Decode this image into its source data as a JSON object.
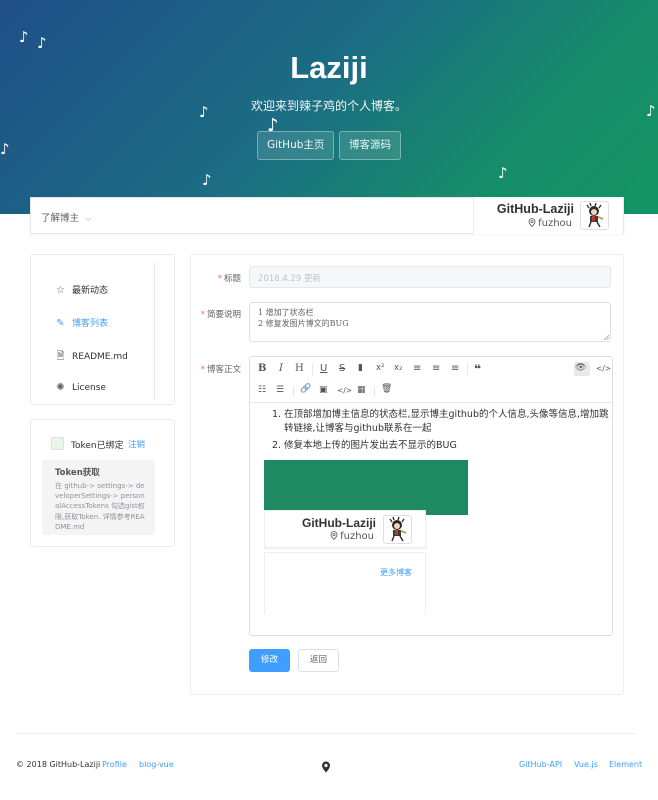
{
  "header": {
    "title": "Laziji",
    "subtitle": "欢迎来到辣子鸡的个人博客。",
    "buttons": [
      "GitHub主页",
      "博客源码"
    ],
    "music_note": "♪"
  },
  "navbar": {
    "menu_label": "了解博主",
    "menu_caret": "⌵",
    "owner_name": "GitHub-Laziji",
    "owner_location": "fuzhou"
  },
  "sidebar": {
    "items": [
      {
        "label": "最新动态",
        "icon": "star-icon",
        "glyph": "☆",
        "active": false
      },
      {
        "label": "博客列表",
        "icon": "edit-icon",
        "glyph": "✎",
        "active": true
      },
      {
        "label": "README.md",
        "icon": "document-icon",
        "glyph": "🗎",
        "active": false
      },
      {
        "label": "License",
        "icon": "gear-icon",
        "glyph": "✺",
        "active": false
      }
    ]
  },
  "token": {
    "label": "Token已绑定",
    "logout": "注销",
    "tip_title": "Token获取",
    "tip_body": "在 github-> settings-> developerSettings-> personalAccessTokens 勾选gist权限,获取Token. 详情参考README.md"
  },
  "form": {
    "title_label": "标题",
    "title_placeholder": "2018.4.29 更新",
    "desc_label": "简要说明",
    "desc_lines": [
      "1 增加了状态栏",
      "2 修复发图片博文的BUG"
    ],
    "body_label": "博客正文",
    "submit_label": "修改",
    "back_label": "返回"
  },
  "editor": {
    "toolbar_row1": [
      "B",
      "I",
      "H",
      "U",
      "S",
      "▮",
      "x²",
      "x₂",
      "≡",
      "≡",
      "≡",
      "❝"
    ],
    "toolbar_row1_names": [
      "bold-icon",
      "italic-icon",
      "heading-icon",
      "underline-icon",
      "strikethrough-icon",
      "bookmark-icon",
      "superscript-icon",
      "subscript-icon",
      "align-left-icon",
      "align-center-icon",
      "align-right-icon",
      "quote-icon"
    ],
    "toolbar_right": [
      "👁",
      "</>"
    ],
    "toolbar_right_names": [
      "preview-eye-icon",
      "code-view-icon"
    ],
    "toolbar_row2": [
      "☷",
      "☰",
      "🔗",
      "▣",
      "</>",
      "▦",
      "🗑"
    ],
    "toolbar_row2_names": [
      "ordered-list-icon",
      "unordered-list-icon",
      "link-icon",
      "image-icon",
      "code-icon",
      "table-icon",
      "trash-icon"
    ],
    "list": [
      {
        "num": "1.",
        "text": "在顶部增加博主信息的状态栏,显示博主github的个人信息,头像等信息,增加跳转链接,让博客与github联系在一起"
      },
      {
        "num": "2.",
        "text": "修复本地上传的图片发出去不显示的BUG"
      }
    ],
    "image": {
      "owner_name": "GitHub-Laziji",
      "owner_location": "fuzhou",
      "more_link": "更多博客"
    }
  },
  "footer": {
    "copyright": "© 2018 GitHub-Laziji",
    "links_left": [
      "Profile",
      "blog-vue"
    ],
    "links_right": [
      "GitHub-API",
      "Vue.js",
      "Element"
    ]
  },
  "colors": {
    "accent": "#409eff",
    "danger": "#f56c6c",
    "hero_start": "#1f4f88",
    "hero_end": "#139563"
  }
}
